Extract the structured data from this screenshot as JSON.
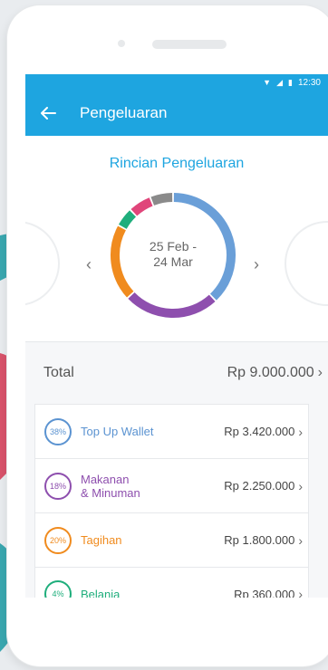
{
  "status_bar": {
    "time": "12:30"
  },
  "header": {
    "title": "Pengeluaran"
  },
  "chart": {
    "heading": "Rincian Pengeluaran",
    "period_line1": "25 Feb -",
    "period_line2": "24 Mar"
  },
  "total": {
    "label": "Total",
    "value": "Rp 9.000.000"
  },
  "categories": [
    {
      "percent": "38%",
      "name": "Top Up Wallet",
      "amount": "Rp 3.420.000",
      "color": "#5b93d1"
    },
    {
      "percent": "18%",
      "name": "Makanan\n& Minuman",
      "amount": "Rp 2.250.000",
      "color": "#8e4fae"
    },
    {
      "percent": "20%",
      "name": "Tagihan",
      "amount": "Rp 1.800.000",
      "color": "#f08b1e"
    },
    {
      "percent": "4%",
      "name": "Belanja",
      "amount": "Rp 360.000",
      "color": "#1fae7c"
    }
  ],
  "chart_data": {
    "type": "pie",
    "categories": [
      "Top Up Wallet",
      "Makanan & Minuman",
      "Tagihan",
      "Belanja",
      "Other (pink)",
      "Other (grey)"
    ],
    "values": [
      38,
      25,
      20,
      5,
      6,
      6
    ],
    "colors": [
      "#6a9fd8",
      "#8e4fae",
      "#f08b1e",
      "#1fae7c",
      "#e0457a",
      "#8a8a8a"
    ]
  }
}
